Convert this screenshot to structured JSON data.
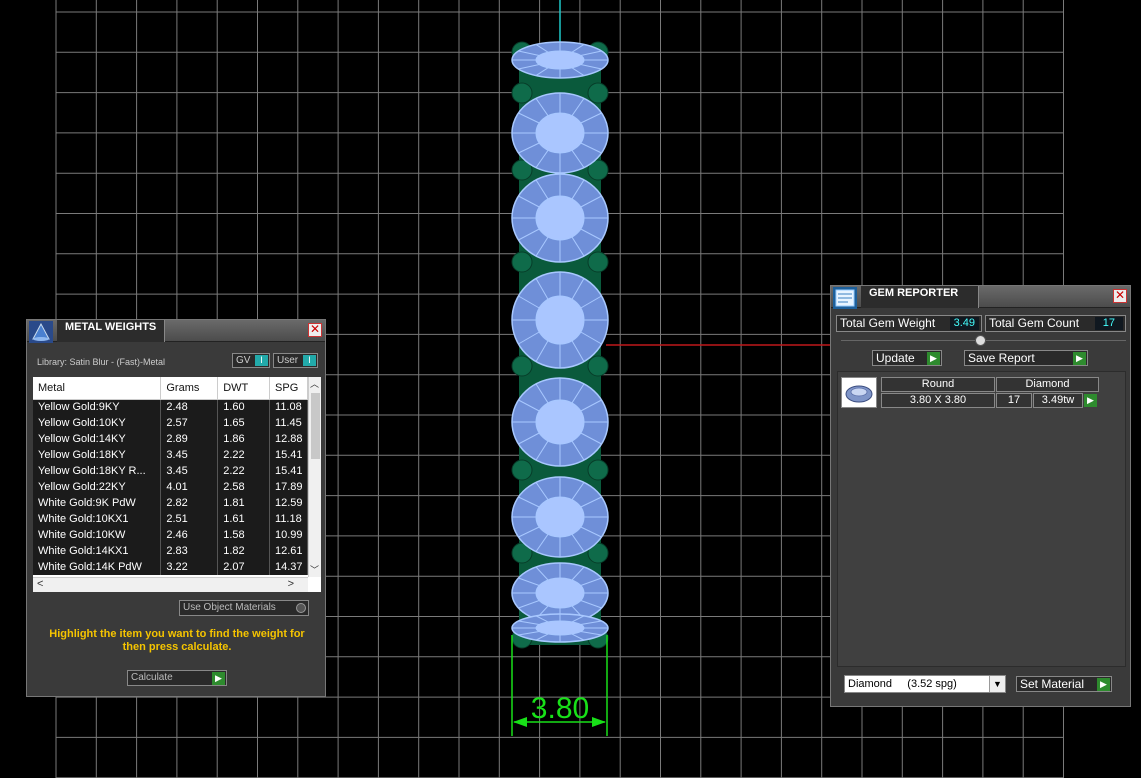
{
  "viewport": {
    "dimension_label": "3.80",
    "colors": {
      "grid": "#7a7a7a",
      "gem": "#a8c8ff",
      "prong": "#0f6b4a",
      "dimension": "#18e018"
    }
  },
  "metal_weights": {
    "title": "METAL WEIGHTS",
    "library": "Library: Satin Blur - (Fast)-Metal",
    "gv_label": "GV",
    "user_label": "User",
    "columns": [
      "Metal",
      "Grams",
      "DWT",
      "SPG"
    ],
    "rows": [
      [
        "Yellow Gold:9KY",
        "2.48",
        "1.60",
        "11.08"
      ],
      [
        "Yellow Gold:10KY",
        "2.57",
        "1.65",
        "11.45"
      ],
      [
        "Yellow Gold:14KY",
        "2.89",
        "1.86",
        "12.88"
      ],
      [
        "Yellow Gold:18KY",
        "3.45",
        "2.22",
        "15.41"
      ],
      [
        "Yellow Gold:18KY R...",
        "3.45",
        "2.22",
        "15.41"
      ],
      [
        "Yellow Gold:22KY",
        "4.01",
        "2.58",
        "17.89"
      ],
      [
        "White Gold:9K PdW",
        "2.82",
        "1.81",
        "12.59"
      ],
      [
        "White Gold:10KX1",
        "2.51",
        "1.61",
        "11.18"
      ],
      [
        "White Gold:10KW",
        "2.46",
        "1.58",
        "10.99"
      ],
      [
        "White Gold:14KX1",
        "2.83",
        "1.82",
        "12.61"
      ],
      [
        "White Gold:14K PdW",
        "3.22",
        "2.07",
        "14.37"
      ]
    ],
    "use_object_materials": "Use Object Materials",
    "hint": "Highlight the item you want to find the weight for then press calculate.",
    "calculate_label": "Calculate"
  },
  "gem_reporter": {
    "title": "GEM REPORTER",
    "total_weight_label": "Total Gem Weight",
    "total_weight_value": "3.49",
    "total_count_label": "Total Gem Count",
    "total_count_value": "17",
    "update_label": "Update",
    "save_report_label": "Save Report",
    "gem_row": {
      "shape": "Round",
      "material": "Diamond",
      "size": "3.80 X 3.80",
      "count": "17",
      "weight": "3.49tw"
    },
    "material_select": "Diamond     (3.52 spg)",
    "set_material_label": "Set Material"
  }
}
